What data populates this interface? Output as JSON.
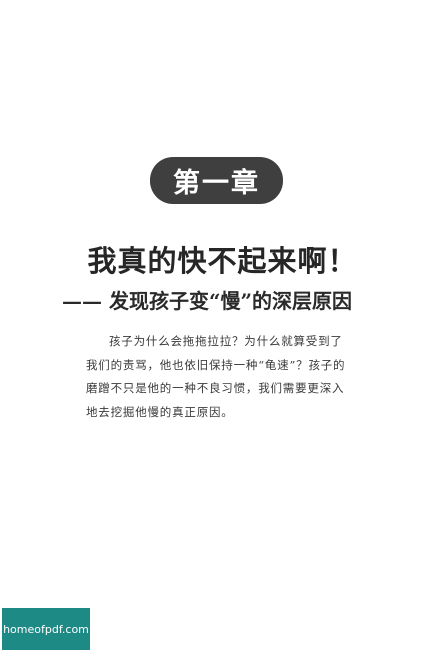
{
  "chapter": {
    "label": "第一章"
  },
  "title": {
    "main": "我真的快不起来啊！",
    "subtitle": "—— 发现孩子变“慢”的深层原因"
  },
  "intro": {
    "text": "孩子为什么会拖拖拉拉？为什么就算受到了我们的责骂，他也依旧保持一种“龟速”？孩子的磨蹭不只是他的一种不良习惯，我们需要更深入地去挖掘他慢的真正原因。"
  },
  "watermark": {
    "text": "homeofpdf.com"
  }
}
